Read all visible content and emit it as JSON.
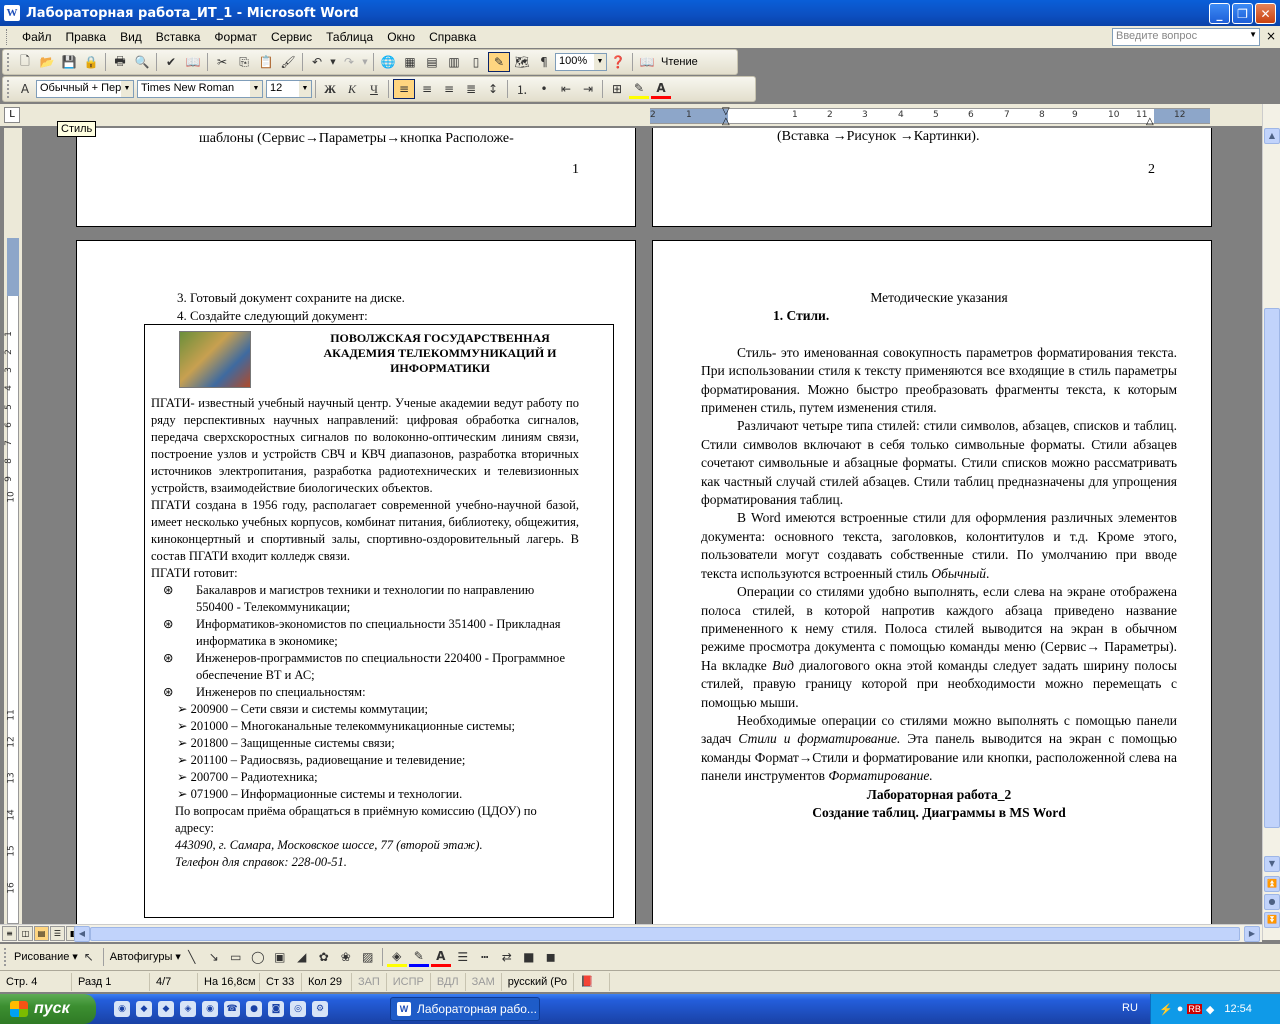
{
  "window": {
    "title": "Лабораторная работа_ИТ_1 - Microsoft Word",
    "app_icon": "W"
  },
  "menu": {
    "items": [
      "Файл",
      "Правка",
      "Вид",
      "Вставка",
      "Формат",
      "Сервис",
      "Таблица",
      "Окно",
      "Справка"
    ],
    "ask_placeholder": "Введите вопрос"
  },
  "toolbar": {
    "zoom": "100%",
    "reading": "Чтение",
    "style": "Обычный + Пер",
    "font": "Times New Roman",
    "size": "12",
    "tooltip": "Стиль"
  },
  "ruler": {
    "h_labels": [
      "2",
      "1",
      "1",
      "2",
      "3",
      "4",
      "5",
      "6",
      "7",
      "8",
      "9",
      "10",
      "11",
      "12"
    ],
    "v_labels": [
      "1",
      "2",
      "3",
      "4",
      "5",
      "6",
      "7",
      "8",
      "9",
      "10",
      "11",
      "12",
      "13",
      "14",
      "15",
      "16"
    ]
  },
  "page1_top": {
    "text": "шаблоны    (Сервис→Параметры→кнопка    Расположе-",
    "num": "1"
  },
  "page2_top": {
    "text": "(Вставка →Рисунок →Картинки).",
    "num": "2"
  },
  "page3": {
    "steps": [
      "3.   Готовый документ сохраните на диске.",
      "4.   Создайте следующий документ:"
    ],
    "box_title": "ПОВОЛЖСКАЯ ГОСУДАРСТВЕННАЯ АКАДЕМИЯ ТЕЛЕКОММУНИКАЦИЙ И ИНФОРМАТИКИ",
    "para1": "ПГАТИ- известный учебный научный центр. Ученые академии ведут работу по ряду перспективных научных направлений: цифровая обработка сигналов, передача сверхскоростных сигналов по волоконно-оптическим линиям связи, построение узлов и устройств СВЧ и КВЧ диапазонов, разработка вторичных источников электропитания, разработка радиотехнических и телевизионных устройств, взаимодействие биологических объектов.",
    "para2": "ПГАТИ создана в 1956 году, располагает современной учебно-научной базой, имеет несколько учебных корпусов, комбинат питания, библиотеку, общежития, киноконцертный и спортивный залы, спортивно-оздоровительный лагерь. В состав ПГАТИ входит колледж связи.",
    "prepares": "ПГАТИ готовит:",
    "bullets": [
      "Бакалавров  и магистров техники и технологии по направлению 550400 - Телекоммуникации;",
      "Информатиков-экономистов по специальности 351400 - Прикладная информатика в экономике;",
      "Инженеров-программистов по специальности 220400 - Программное обеспечение ВТ и АС;",
      "Инженеров по специальностям:"
    ],
    "subs": [
      "200900 – Сети связи и системы коммутации;",
      "201000 – Многоканальные телекоммуникационные системы;",
      "201800 – Защищенные системы связи;",
      "201100 – Радиосвязь, радиовещание и телевидение;",
      "200700 – Радиотехника;",
      "071900 – Информационные системы и технологии."
    ],
    "contact1": "По вопросам приёма обращаться в приёмную комиссию (ЦДОУ) по адресу:",
    "address": "443090, г. Самара, Московское шоссе, 77 (второй  этаж).",
    "phone": "Телефон для справок: 228-00-51."
  },
  "page4": {
    "heading": "Методические указания",
    "section": "1.   Стили.",
    "p1": "Стиль- это именованная совокупность параметров форматирования текста. При использовании стиля к тексту применяются все входящие в стиль параметры форматирования. Можно быстро преобразовать фрагменты текста, к которым применен стиль, путем изменения стиля.",
    "p2": "Различают четыре типа стилей: стили символов, абзацев, списков и таблиц. Стили символов включают в себя только символьные форматы. Стили абзацев сочетают символьные и абзацные форматы. Стили списков можно рассматривать как частный случай стилей абзацев. Стили таблиц предназначены для упрощения форматирования таблиц.",
    "p3a": "В Word имеются встроенные стили для оформления различных элементов документа: основного текста, заголовков, колонтитулов и т.д. Кроме этого, пользователи могут создавать собственные стили. По умолчанию при вводе текста используются встроенный стиль ",
    "p3b": "Обычный",
    "p4a": "Операции со стилями удобно выполнять, если слева на экране отображена полоса стилей, в которой напротив каждого абзаца приведено название примененного к нему стиля. Полоса стилей выводится на экран в обычном режиме просмотра документа с помощью команды меню (Сервис→ Параметры). На вкладке ",
    "p4b": "Вид",
    "p4c": " диалогового окна этой команды следует задать ширину полосы стилей, правую границу которой при необходимости можно перемещать с помощью мыши.",
    "p5a": "Необходимые операции со стилями можно выполнять с помощью панели задач ",
    "p5b": "Стили и форматирование.",
    "p5c": " Эта панель выводится на экран с помощью команды Формат→Стили и форматирование или кнопки, расположенной слева на панели инструментов ",
    "p5d": "Форматирование.",
    "lab": "Лабораторная работа_2",
    "lab_sub": "Создание таблиц. Диаграммы в MS Word"
  },
  "drawbar": {
    "draw": "Рисование",
    "autoshapes": "Автофигуры"
  },
  "status": {
    "page": "Стр. 4",
    "section": "Разд 1",
    "pages": "4/7",
    "at": "На 16,8см",
    "line": "Ст 33",
    "col": "Кол 29",
    "rec": "ЗАП",
    "trk": "ИСПР",
    "ext": "ВДЛ",
    "ovr": "ЗАМ",
    "lang": "русский (Ро"
  },
  "taskbar": {
    "start": "пуск",
    "task": "Лабораторная рабо...",
    "lang": "RU",
    "time": "12:54"
  }
}
